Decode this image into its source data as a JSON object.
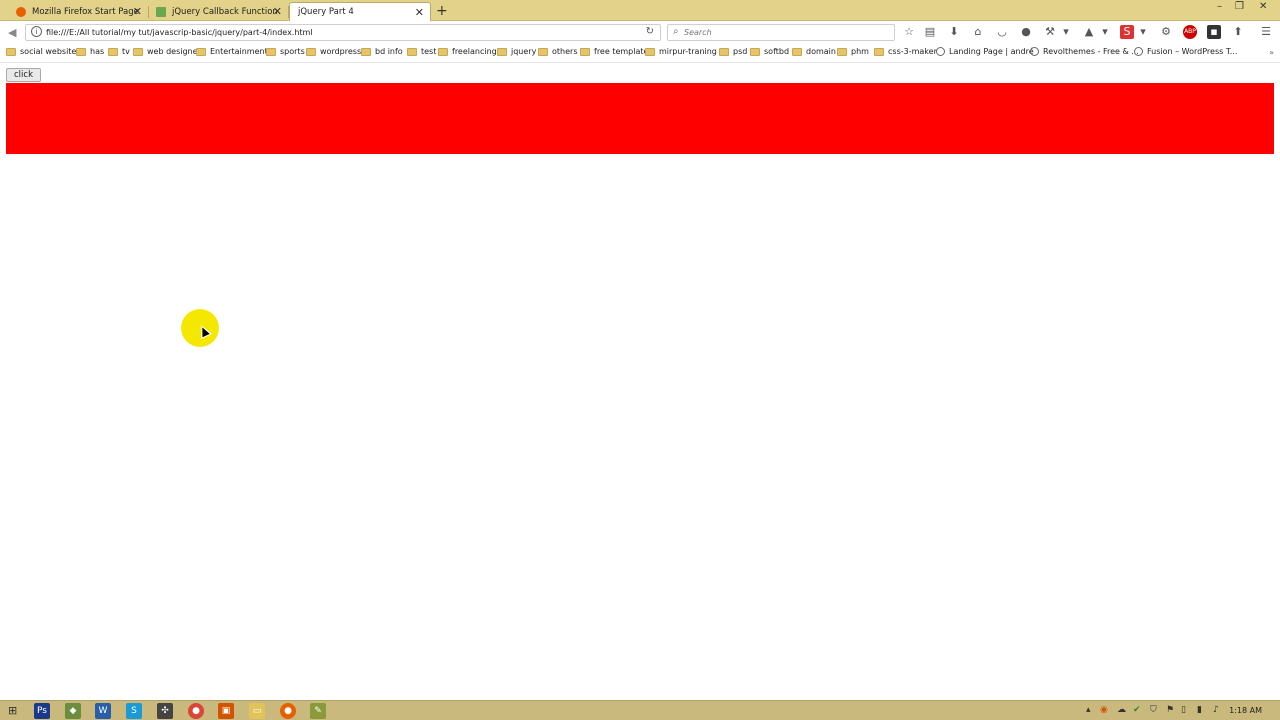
{
  "browser": {
    "tabs": [
      {
        "label": "Mozilla Firefox Start Page",
        "favicon_color": "#e66000"
      },
      {
        "label": "jQuery Callback Function",
        "favicon_color": "#6aa84f"
      },
      {
        "label": "jQuery Part 4",
        "favicon_color": ""
      }
    ],
    "new_tab": "+",
    "tab_close": "✕",
    "window": {
      "minimize": "–",
      "restore": "❐",
      "close": "✕"
    },
    "url": "file:///E:/All tutorial/my tut/javascrip-basic/jquery/part-4/index.html",
    "search_placeholder": "Search",
    "bookmarks": [
      {
        "label": "social website",
        "type": "folder"
      },
      {
        "label": "has",
        "type": "folder"
      },
      {
        "label": "tv",
        "type": "folder"
      },
      {
        "label": "web designe",
        "type": "folder"
      },
      {
        "label": "Entertainment",
        "type": "folder"
      },
      {
        "label": "sports",
        "type": "folder"
      },
      {
        "label": "wordpress",
        "type": "folder"
      },
      {
        "label": "bd info",
        "type": "folder"
      },
      {
        "label": "test",
        "type": "folder"
      },
      {
        "label": "freelancing",
        "type": "folder"
      },
      {
        "label": "jquery",
        "type": "folder"
      },
      {
        "label": "others",
        "type": "folder"
      },
      {
        "label": "free template",
        "type": "folder"
      },
      {
        "label": "mirpur-traning",
        "type": "folder"
      },
      {
        "label": "psd",
        "type": "folder"
      },
      {
        "label": "softbd",
        "type": "folder"
      },
      {
        "label": "domain",
        "type": "folder"
      },
      {
        "label": "phm",
        "type": "folder"
      },
      {
        "label": "css-3-maker",
        "type": "folder"
      },
      {
        "label": "Landing Page | andré",
        "type": "link"
      },
      {
        "label": "Revolthemes - Free & ...",
        "type": "link"
      },
      {
        "label": "Fusion – WordPress T...",
        "type": "link"
      }
    ],
    "bookmarks_more": "»"
  },
  "page": {
    "button_label": "click",
    "box_color": "#ff0000"
  },
  "taskbar": {
    "clock": "1:18 AM"
  }
}
